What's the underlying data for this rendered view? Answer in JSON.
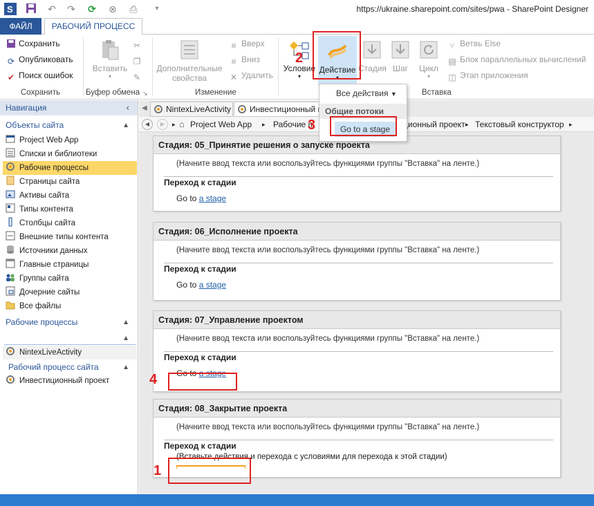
{
  "window": {
    "title": "https://ukraine.sharepoint.com/sites/pwa - SharePoint Designer"
  },
  "ribbon_tabs": {
    "file": "ФАЙЛ",
    "workflow": "РАБОЧИЙ ПРОЦЕСС"
  },
  "ribbon": {
    "save": "Сохранить",
    "publish": "Опубликовать",
    "check_errors": "Поиск ошибок",
    "group_save": "Сохранить",
    "paste": "Вставить",
    "group_clipboard": "Буфер обмена",
    "advanced_properties_1": "Дополнительные",
    "advanced_properties_2": "свойства",
    "move_up": "Вверх",
    "move_down": "Вниз",
    "delete": "Удалить",
    "group_modify": "Изменение",
    "condition": "Условие",
    "action": "Действие",
    "stage": "Стадия",
    "step": "Шаг",
    "loop": "Цикл",
    "else_branch": "Ветвь Else",
    "parallel_block": "Блок параллельных вычислений",
    "app_step": "Этап приложения",
    "group_insert": "Вставка"
  },
  "dropdown": {
    "all_actions": "Все действия",
    "common_flows": "Общие потоки",
    "goto_stage": "Go to a stage"
  },
  "nav": {
    "header": "Навигация",
    "site_objects": "Объекты сайта",
    "items": [
      {
        "label": "Project Web App",
        "icon": "site-icon"
      },
      {
        "label": "Списки и библиотеки",
        "icon": "lists-icon"
      },
      {
        "label": "Рабочие процессы",
        "icon": "workflow-icon"
      },
      {
        "label": "Страницы сайта",
        "icon": "pages-icon"
      },
      {
        "label": "Активы сайта",
        "icon": "assets-icon"
      },
      {
        "label": "Типы контента",
        "icon": "content-types-icon"
      },
      {
        "label": "Столбцы сайта",
        "icon": "columns-icon"
      },
      {
        "label": "Внешние типы контента",
        "icon": "external-types-icon"
      },
      {
        "label": "Источники данных",
        "icon": "data-sources-icon"
      },
      {
        "label": "Главные страницы",
        "icon": "master-pages-icon"
      },
      {
        "label": "Группы сайта",
        "icon": "groups-icon"
      },
      {
        "label": "Дочерние сайты",
        "icon": "subsites-icon"
      },
      {
        "label": "Все файлы",
        "icon": "folder-icon"
      }
    ],
    "workflows_section": "Рабочие процессы",
    "nintex_item": "NintexLiveActivity",
    "site_workflow_section": "Рабочий процесс сайта",
    "investment_item": "Инвестиционный проект"
  },
  "doc_tabs": {
    "tab1": "NintexLiveActivity",
    "tab2": "Инвестиционный п"
  },
  "breadcrumb": {
    "item1": "Project Web App",
    "item2": "Рабочие п",
    "item3": "ционный проект",
    "item4": "Текстовый конструктор"
  },
  "stages": [
    {
      "title": "Стадия: 05_Принятие решения о запуске проекта",
      "hint": "(Начните ввод текста или воспользуйтесь функциями группы \"Вставка\" на ленте.)",
      "transition": "Переход к стадии",
      "goto_prefix": "Go to",
      "goto_link": "a stage"
    },
    {
      "title": "Стадия: 06_Исполнение проекта",
      "hint": "(Начните ввод текста или воспользуйтесь функциями группы \"Вставка\" на ленте.)",
      "transition": "Переход к стадии",
      "goto_prefix": "Go to",
      "goto_link": "a stage"
    },
    {
      "title": "Стадия: 07_Управление проектом",
      "hint": "(Начните ввод текста или воспользуйтесь функциями группы \"Вставка\" на ленте.)",
      "transition": "Переход к стадии",
      "goto_prefix": "Go to",
      "goto_link": "a stage"
    },
    {
      "title": "Стадия: 08_Закрытие проекта",
      "hint": "(Начните ввод текста или воспользуйтесь функциями группы \"Вставка\" на ленте.)",
      "transition": "Переход к стадии",
      "insert_hint": "(Вставьте действия и перехода с условиями для перехода к этой стадии)"
    }
  ],
  "annotations": {
    "n1": "1",
    "n2": "2",
    "n3": "3",
    "n4": "4"
  },
  "colors": {
    "accent": "#2b579a",
    "annotation_red": "#e02020",
    "selected_nav": "#fcd768",
    "dropdown_highlight": "#cfe4f7"
  }
}
